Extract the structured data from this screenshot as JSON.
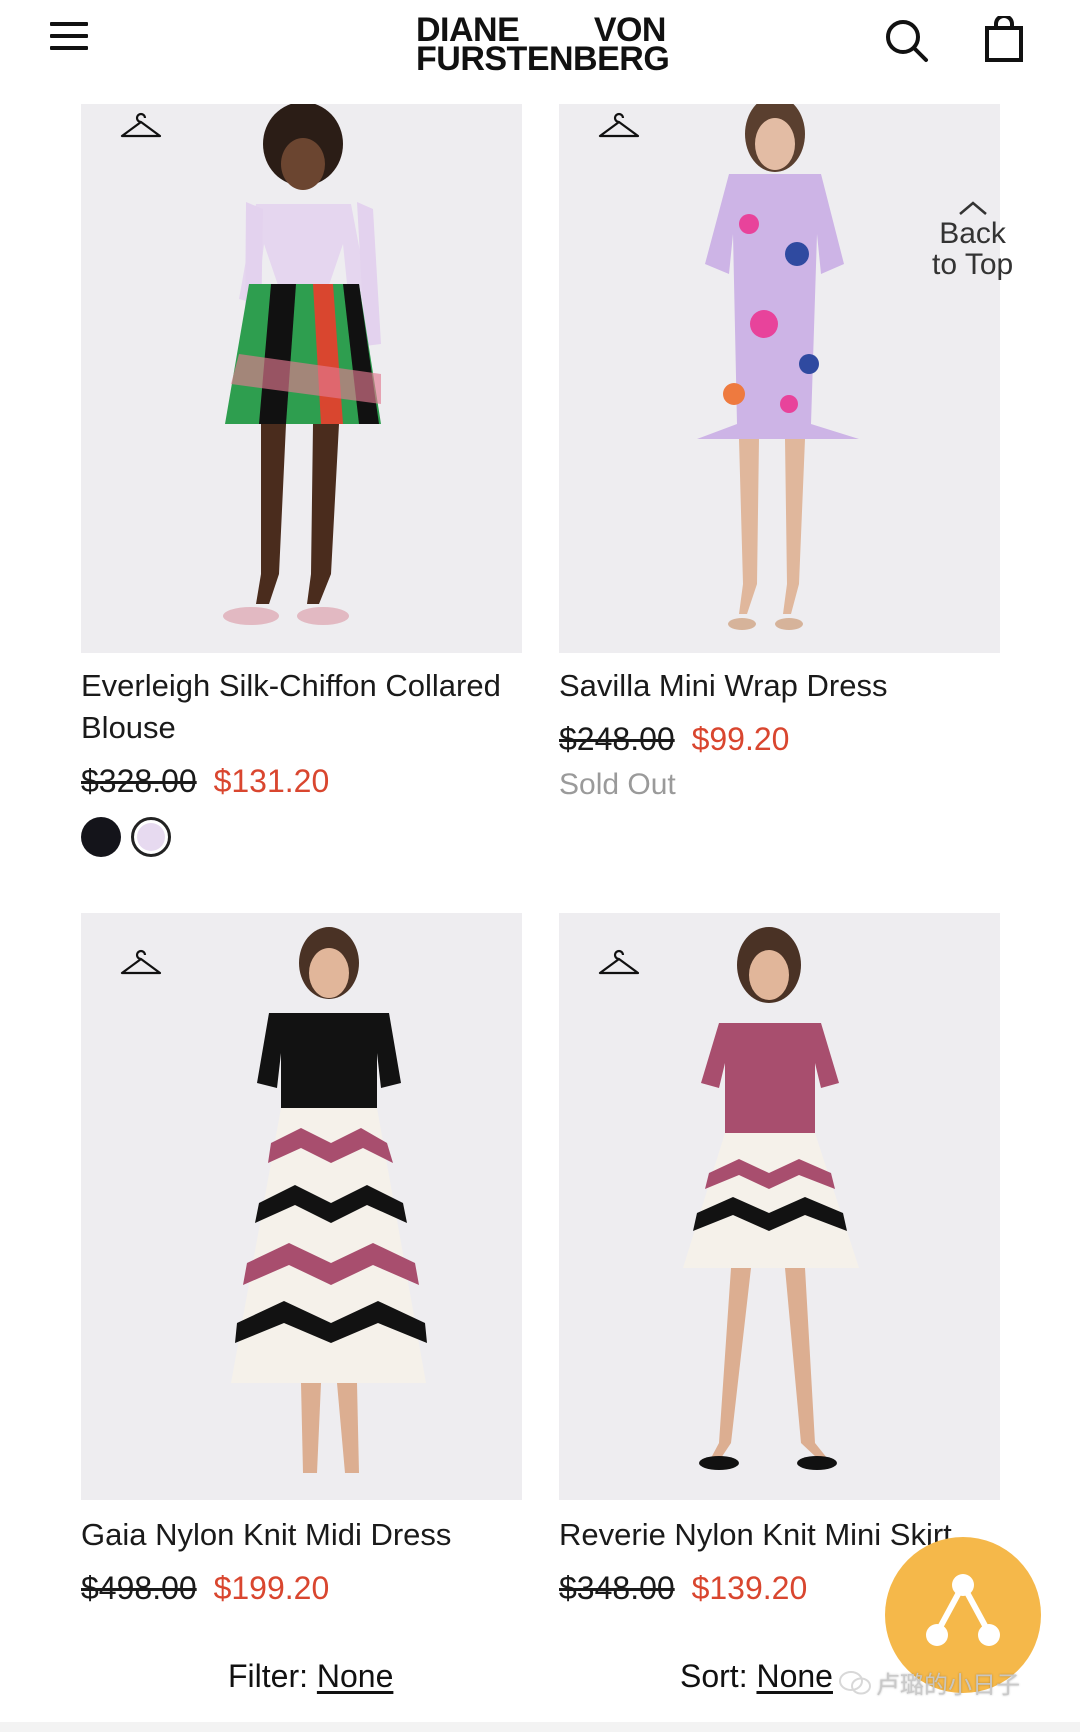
{
  "header": {
    "logo_line1_left": "DIANE",
    "logo_line1_right": "VON",
    "logo_line2": "FURSTENBERG"
  },
  "back_to_top": {
    "line1": "Back",
    "line2": "to Top"
  },
  "products": [
    {
      "name": "Everleigh Silk-Chiffon Collared Blouse",
      "original_price": "$328.00",
      "sale_price": "$131.20",
      "swatch_colors": [
        "#14141a",
        "#e7daf0"
      ]
    },
    {
      "name": "Savilla Mini Wrap Dress",
      "original_price": "$248.00",
      "sale_price": "$99.20",
      "status": "Sold Out"
    },
    {
      "name": "Gaia Nylon Knit Midi Dress",
      "original_price": "$498.00",
      "sale_price": "$199.20"
    },
    {
      "name": "Reverie Nylon Knit Mini Skirt",
      "original_price": "$348.00",
      "sale_price": "$139.20"
    }
  ],
  "bottom_bar": {
    "filter_label": "Filter:",
    "filter_value": "None",
    "sort_label": "Sort:",
    "sort_value": "None"
  },
  "watermark": {
    "text": "卢璐的小日子"
  },
  "colors": {
    "sale_red": "#d9462f",
    "image_background": "#eeedf0",
    "share_button": "#f5b84a"
  }
}
